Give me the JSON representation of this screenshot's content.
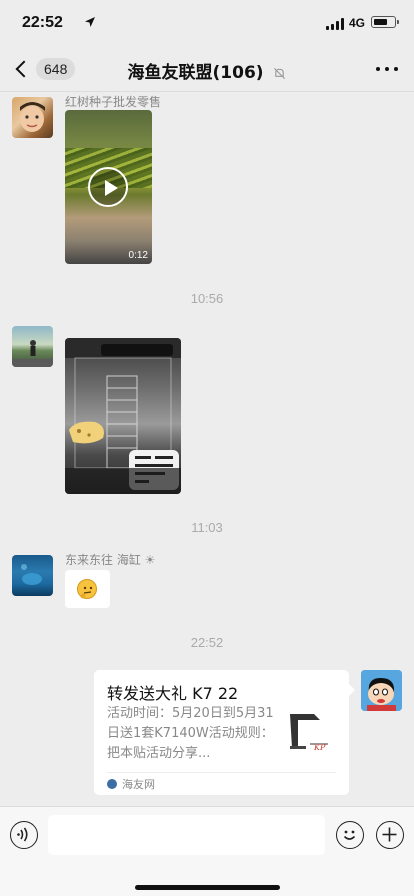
{
  "status_bar": {
    "time": "22:52",
    "network": "4G"
  },
  "nav": {
    "unread_count": "648",
    "title": "海鱼友联盟(106)"
  },
  "messages": [
    {
      "sender": "红树种子批发零售",
      "type": "video",
      "duration": "0:12"
    },
    {
      "timestamp": "10:56"
    },
    {
      "type": "image"
    },
    {
      "timestamp": "11:03"
    },
    {
      "sender": "东来东往 海缸 ☀",
      "type": "sticker"
    },
    {
      "timestamp": "22:52"
    },
    {
      "type": "link_card",
      "title": "转发送大礼 K7 22",
      "description": "活动时间：5月20日到5月31日送1套K7140W活动规则：把本贴活动分享...",
      "source": "海友网"
    }
  ],
  "icons": {
    "back": "chevron-left-icon",
    "mute": "bell-slash-icon",
    "more": "more-dots-icon",
    "voice": "voice-icon",
    "emoji": "emoji-icon",
    "plus": "plus-icon"
  }
}
